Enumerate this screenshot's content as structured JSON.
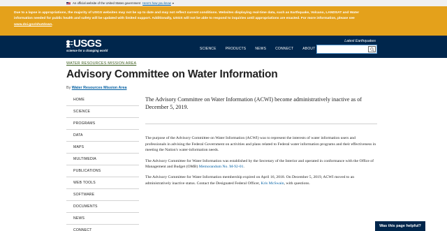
{
  "gov_banner": {
    "text": "An official website of the United States government",
    "link": "Here's how you know"
  },
  "alert": {
    "text": "Due to a lapse in appropriations, the majority of USGS websites may not be up to date and may not reflect current conditions. Websites displaying real-time data, such as Earthquake, Volcano, LANDSAT and Water information needed for public health and safety will be updated with limited support. Additionally, USGS will not be able to respond to inquiries until appropriations are enacted. For more information, please see ",
    "link": "www.doi.gov/shutdown",
    "suffix": "."
  },
  "header": {
    "logo_text": "USGS",
    "logo_tagline": "science for a changing world",
    "nav": [
      "SCIENCE",
      "PRODUCTS",
      "NEWS",
      "CONNECT",
      "ABOUT"
    ],
    "latest_earthquakes": "Latest Earthquakes",
    "search_value": ""
  },
  "breadcrumb": "WATER RESOURCES MISSION AREA",
  "page_title": "Advisory Committee on Water Information",
  "byline": {
    "prefix": "By",
    "author": "Water Resources Mission Area"
  },
  "sidenav": [
    "HOME",
    "SCIENCE",
    "PROGRAMS",
    "DATA",
    "MAPS",
    "MULTIMEDIA",
    "PUBLICATIONS",
    "WEB TOOLS",
    "SOFTWARE",
    "DOCUMENTS",
    "NEWS",
    "CONNECT"
  ],
  "content": {
    "lead": "The Advisory Committee on Water Information (ACWI) become administratively inactive as of December 5, 2019.",
    "p1": "The purpose of the Advisory Committee on Water Information (ACWI) was to represent the interests of water information users and professionals in advising the Federal Government on activities and plans related to Federal water information programs and their effectiveness in meeting the Nation's water-information needs.",
    "p2_prefix": "The Advisory Committee for Water Information was established by the Secretary of the Interior and operated in conformance with the Office of Management and Budget (OMB) ",
    "p2_link": "Memorandum No. M-92-01",
    "p2_suffix": ".",
    "p3_prefix": "The Advisory Committee for Water Information membership expired on April 16, 2018. On December 5, 2019, ACWI moved to an administratively inactive status. Contact the Designated Federal Officer, ",
    "p3_link": "Kris McSwain",
    "p3_suffix": ", with questions."
  },
  "feedback_button": "Was this page helpful?",
  "colors": {
    "alert_bg": "#e4a11b",
    "header_bg": "#00264c",
    "breadcrumb": "#3b5d1d",
    "link": "#005ea2"
  }
}
